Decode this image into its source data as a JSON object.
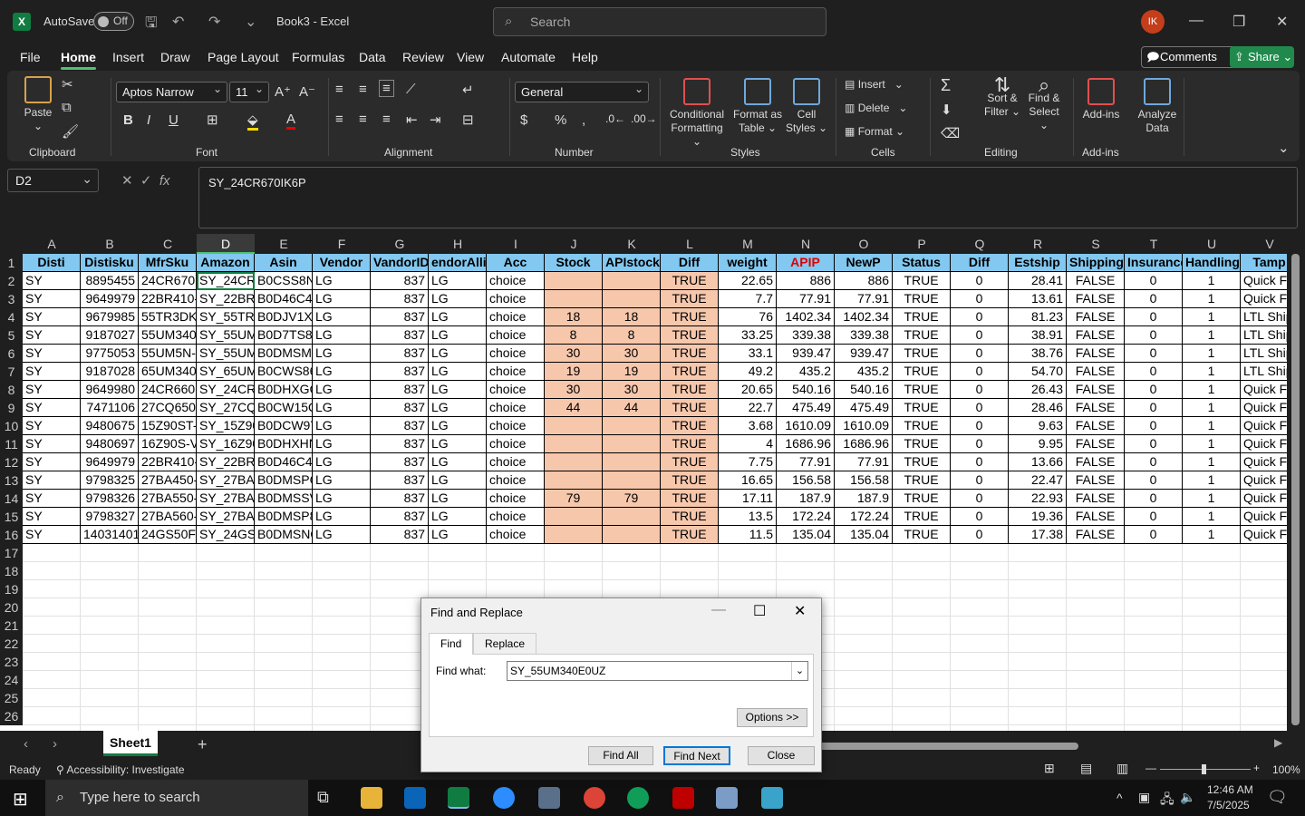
{
  "titlebar": {
    "autosave_label": "AutoSave",
    "autosave_state": "Off",
    "document_title": "Book3 - Excel",
    "search_placeholder": "Search",
    "user_initials": "IK"
  },
  "menu": [
    "File",
    "Home",
    "Insert",
    "Draw",
    "Page Layout",
    "Formulas",
    "Data",
    "Review",
    "View",
    "Automate",
    "Help"
  ],
  "menu_active": "Home",
  "comments_label": "Comments",
  "share_label": "Share",
  "ribbon": {
    "clipboard": {
      "paste": "Paste",
      "label": "Clipboard"
    },
    "font": {
      "name": "Aptos Narrow",
      "size": "11",
      "label": "Font"
    },
    "alignment": {
      "label": "Alignment"
    },
    "number": {
      "format": "General",
      "label": "Number"
    },
    "styles": {
      "cond_line1": "Conditional",
      "cond_line2": "Formatting",
      "table_line1": "Format as",
      "table_line2": "Table",
      "cell_line1": "Cell",
      "cell_line2": "Styles",
      "label": "Styles"
    },
    "cells": {
      "insert": "Insert",
      "delete": "Delete",
      "format": "Format",
      "label": "Cells"
    },
    "editing": {
      "sort_line1": "Sort &",
      "sort_line2": "Filter",
      "find_line1": "Find &",
      "find_line2": "Select",
      "label": "Editing"
    },
    "addins": {
      "addins": "Add-ins",
      "analyze_line1": "Analyze",
      "analyze_line2": "Data",
      "label": "Add-ins"
    }
  },
  "formula_bar": {
    "name_box": "D2",
    "formula": "SY_24CR670IK6P"
  },
  "sheet": {
    "columns": [
      "A",
      "B",
      "C",
      "D",
      "E",
      "F",
      "G",
      "H",
      "I",
      "J",
      "K",
      "L",
      "M",
      "N",
      "O",
      "P",
      "Q",
      "R",
      "S",
      "T",
      "U",
      "V"
    ],
    "rows": [
      "1",
      "2",
      "3",
      "4",
      "5",
      "6",
      "7",
      "8",
      "9",
      "10",
      "11",
      "12",
      "13",
      "14",
      "15",
      "16",
      "17",
      "18",
      "19",
      "20",
      "21",
      "22",
      "23",
      "24",
      "25",
      "26"
    ],
    "headers": [
      "Disti",
      "Distisku",
      "MfrSku",
      "Amazon",
      "Asin",
      "Vendor",
      "VandorID",
      "endorAllia",
      "Acc",
      "Stock",
      "APIstock",
      "Diff",
      "weight",
      "APIP",
      "NewP",
      "Status",
      "Diff",
      "Estship",
      "Shipping",
      "Insurance",
      "Handling",
      "Tamp"
    ],
    "data": [
      [
        "SY",
        "8895455",
        "24CR670IK",
        "SY_24CR67",
        "B0CSS8NK",
        "LG",
        "837",
        "LG",
        "choice",
        "",
        "",
        "TRUE",
        "22.65",
        "886",
        "886",
        "TRUE",
        "0",
        "28.41",
        "FALSE",
        "0",
        "1",
        "Quick F"
      ],
      [
        "SY",
        "9649979",
        "22BR410-E",
        "SY_22BR41",
        "B0D46C4T",
        "LG",
        "837",
        "LG",
        "choice",
        "",
        "",
        "TRUE",
        "7.7",
        "77.91",
        "77.91",
        "TRUE",
        "0",
        "13.61",
        "FALSE",
        "0",
        "1",
        "Quick F"
      ],
      [
        "SY",
        "9679985",
        "55TR3DK-E",
        "SY_55TR3D",
        "B0DJV1XH",
        "LG",
        "837",
        "LG",
        "choice",
        "18",
        "18",
        "TRUE",
        "76",
        "1402.34",
        "1402.34",
        "TRUE",
        "0",
        "81.23",
        "FALSE",
        "0",
        "1",
        "LTL Ship"
      ],
      [
        "SY",
        "9187027",
        "55UM340E",
        "SY_55UM3",
        "B0D7TS85",
        "LG",
        "837",
        "LG",
        "choice",
        "8",
        "8",
        "TRUE",
        "33.25",
        "339.38",
        "339.38",
        "TRUE",
        "0",
        "38.91",
        "FALSE",
        "0",
        "1",
        "LTL Ship"
      ],
      [
        "SY",
        "9775053",
        "55UM5N-E",
        "SY_55UM5",
        "B0DMSM9",
        "LG",
        "837",
        "LG",
        "choice",
        "30",
        "30",
        "TRUE",
        "33.1",
        "939.47",
        "939.47",
        "TRUE",
        "0",
        "38.76",
        "FALSE",
        "0",
        "1",
        "LTL Ship"
      ],
      [
        "SY",
        "9187028",
        "65UM340E",
        "SY_65UM3",
        "B0CWS86L",
        "LG",
        "837",
        "LG",
        "choice",
        "19",
        "19",
        "TRUE",
        "49.2",
        "435.2",
        "435.2",
        "TRUE",
        "0",
        "54.70",
        "FALSE",
        "0",
        "1",
        "LTL Ship"
      ],
      [
        "SY",
        "9649980",
        "24CR660N",
        "SY_24CR66",
        "B0DHXGQ",
        "LG",
        "837",
        "LG",
        "choice",
        "30",
        "30",
        "TRUE",
        "20.65",
        "540.16",
        "540.16",
        "TRUE",
        "0",
        "26.43",
        "FALSE",
        "0",
        "1",
        "Quick F"
      ],
      [
        "SY",
        "7471106",
        "27CQ650N",
        "SY_27CQ6",
        "B0CW15Q",
        "LG",
        "837",
        "LG",
        "choice",
        "44",
        "44",
        "TRUE",
        "22.7",
        "475.49",
        "475.49",
        "TRUE",
        "0",
        "28.46",
        "FALSE",
        "0",
        "1",
        "Quick F"
      ],
      [
        "SY",
        "9480675",
        "15Z90ST-V",
        "SY_15Z90S",
        "B0DCW9Y",
        "LG",
        "837",
        "LG",
        "choice",
        "",
        "",
        "TRUE",
        "3.68",
        "1610.09",
        "1610.09",
        "TRUE",
        "0",
        "9.63",
        "FALSE",
        "0",
        "1",
        "Quick F"
      ],
      [
        "SY",
        "9480697",
        "16Z90S-V.",
        "SY_16Z90S",
        "B0DHXHN",
        "LG",
        "837",
        "LG",
        "choice",
        "",
        "",
        "TRUE",
        "4",
        "1686.96",
        "1686.96",
        "TRUE",
        "0",
        "9.95",
        "FALSE",
        "0",
        "1",
        "Quick F"
      ],
      [
        "SY",
        "9649979",
        "22BR410-E",
        "SY_22BR41",
        "B0D46C4T",
        "LG",
        "837",
        "LG",
        "choice",
        "",
        "",
        "TRUE",
        "7.75",
        "77.91",
        "77.91",
        "TRUE",
        "0",
        "13.66",
        "FALSE",
        "0",
        "1",
        "Quick F"
      ],
      [
        "SY",
        "9798325",
        "27BA450-E",
        "SY_27BA45",
        "B0DMSPC",
        "LG",
        "837",
        "LG",
        "choice",
        "",
        "",
        "TRUE",
        "16.65",
        "156.58",
        "156.58",
        "TRUE",
        "0",
        "22.47",
        "FALSE",
        "0",
        "1",
        "Quick F"
      ],
      [
        "SY",
        "9798326",
        "27BA550-E",
        "SY_27BA55",
        "B0DMSSV",
        "LG",
        "837",
        "LG",
        "choice",
        "79",
        "79",
        "TRUE",
        "17.11",
        "187.9",
        "187.9",
        "TRUE",
        "0",
        "22.93",
        "FALSE",
        "0",
        "1",
        "Quick F"
      ],
      [
        "SY",
        "9798327",
        "27BA560-E",
        "SY_27BA56",
        "B0DMSP8",
        "LG",
        "837",
        "LG",
        "choice",
        "",
        "",
        "TRUE",
        "13.5",
        "172.24",
        "172.24",
        "TRUE",
        "0",
        "19.36",
        "FALSE",
        "0",
        "1",
        "Quick F"
      ],
      [
        "SY",
        "14031401",
        "24GS50FX",
        "SY_24GS5",
        "B0DMSNQ",
        "LG",
        "837",
        "LG",
        "choice",
        "",
        "",
        "TRUE",
        "11.5",
        "135.04",
        "135.04",
        "TRUE",
        "0",
        "17.38",
        "FALSE",
        "0",
        "1",
        "Quick F"
      ]
    ],
    "tab_name": "Sheet1"
  },
  "status": {
    "ready": "Ready",
    "accessibility": "Accessibility: Investigate",
    "zoom": "100%"
  },
  "taskbar": {
    "search_placeholder": "Type here to search",
    "time": "12:46 AM",
    "date": "7/5/2025"
  },
  "dialog": {
    "title": "Find and Replace",
    "tab_find": "Find",
    "tab_replace": "Replace",
    "find_label": "Find what:",
    "find_value": "SY_55UM340E0UZ",
    "options_label": "Options >>",
    "find_all_label": "Find All",
    "find_next_label": "Find Next",
    "close_label": "Close"
  }
}
